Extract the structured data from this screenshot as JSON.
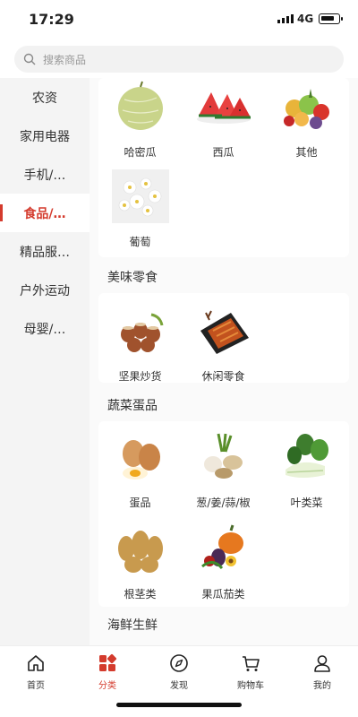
{
  "status": {
    "time": "17:29",
    "network": "4G"
  },
  "search": {
    "placeholder": "搜索商品"
  },
  "sidebar": {
    "items": [
      {
        "label": "农资"
      },
      {
        "label": "家用电器"
      },
      {
        "label": "手机/…"
      },
      {
        "label": "食品/…",
        "active": true
      },
      {
        "label": "精品服…"
      },
      {
        "label": "户外运动"
      },
      {
        "label": "母婴/…"
      }
    ]
  },
  "sections": {
    "fruit": {
      "items": [
        {
          "label": "哈密瓜",
          "icon": "melon-icon"
        },
        {
          "label": "西瓜",
          "icon": "watermelon-icon"
        },
        {
          "label": "其他",
          "icon": "mixed-fruit-icon"
        },
        {
          "label": "葡萄",
          "icon": "grape-flower-icon"
        }
      ]
    },
    "snacks": {
      "title": "美味零食",
      "items": [
        {
          "label": "坚果炒货",
          "icon": "hazelnut-icon"
        },
        {
          "label": "休闲零食",
          "icon": "snack-plate-icon"
        }
      ]
    },
    "veg": {
      "title": "蔬菜蛋品",
      "items": [
        {
          "label": "蛋品",
          "icon": "egg-icon"
        },
        {
          "label": "葱/姜/蒜/椒",
          "icon": "garlic-ginger-icon"
        },
        {
          "label": "叶类菜",
          "icon": "bok-choy-icon"
        },
        {
          "label": "根茎类",
          "icon": "potato-icon"
        },
        {
          "label": "果瓜茄类",
          "icon": "pumpkin-eggplant-icon"
        }
      ]
    },
    "seafood": {
      "title": "海鲜生鲜"
    }
  },
  "tabbar": {
    "items": [
      {
        "label": "首页",
        "icon": "home-icon"
      },
      {
        "label": "分类",
        "icon": "category-icon",
        "active": true
      },
      {
        "label": "发现",
        "icon": "compass-icon"
      },
      {
        "label": "购物车",
        "icon": "cart-icon"
      },
      {
        "label": "我的",
        "icon": "user-icon"
      }
    ]
  },
  "colors": {
    "accent": "#d43b2d"
  }
}
